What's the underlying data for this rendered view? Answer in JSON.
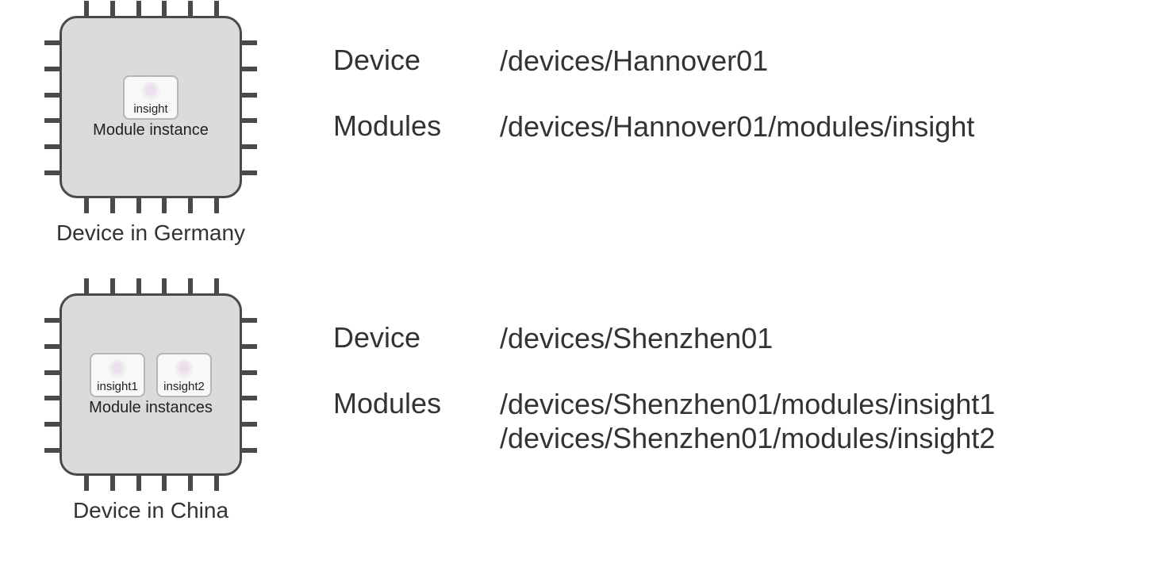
{
  "devices": [
    {
      "caption": "Device in Germany",
      "module_caption": "Module instance",
      "modules": [
        "insight"
      ],
      "info": {
        "device_label": "Device",
        "device_path": "/devices/Hannover01",
        "modules_label": "Modules",
        "module_paths": [
          "/devices/Hannover01/modules/insight"
        ]
      }
    },
    {
      "caption": "Device in China",
      "module_caption": "Module instances",
      "modules": [
        "insight1",
        "insight2"
      ],
      "info": {
        "device_label": "Device",
        "device_path": "/devices/Shenzhen01",
        "modules_label": "Modules",
        "module_paths": [
          "/devices/Shenzhen01/modules/insight1",
          "/devices/Shenzhen01/modules/insight2"
        ]
      }
    }
  ]
}
